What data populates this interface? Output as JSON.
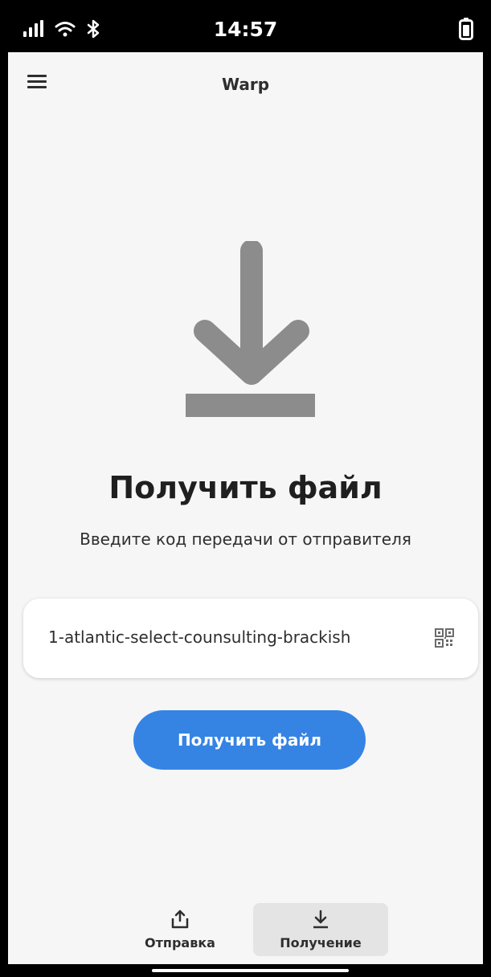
{
  "status_bar": {
    "time": "14:57",
    "icons": [
      "signal-icon",
      "wifi-icon",
      "bluetooth-icon",
      "battery-icon"
    ]
  },
  "header": {
    "title": "Warp",
    "menu_icon": "hamburger-menu-icon"
  },
  "main": {
    "hero_icon": "download-icon",
    "title": "Получить файл",
    "subtitle": "Введите код передачи от отправителя",
    "code_input": {
      "value": "1-atlantic-select-counsulting-brackish",
      "trailing_icon": "qr-code-icon"
    },
    "receive_button_label": "Получить файл"
  },
  "bottom_nav": {
    "items": [
      {
        "label": "Отправка",
        "icon": "upload-icon",
        "selected": false
      },
      {
        "label": "Получение",
        "icon": "download-icon",
        "selected": true
      }
    ]
  },
  "colors": {
    "accent": "#3584e4",
    "background": "#f6f6f6",
    "icon_gray": "#8c8c8c",
    "text": "#2e2e2e"
  }
}
